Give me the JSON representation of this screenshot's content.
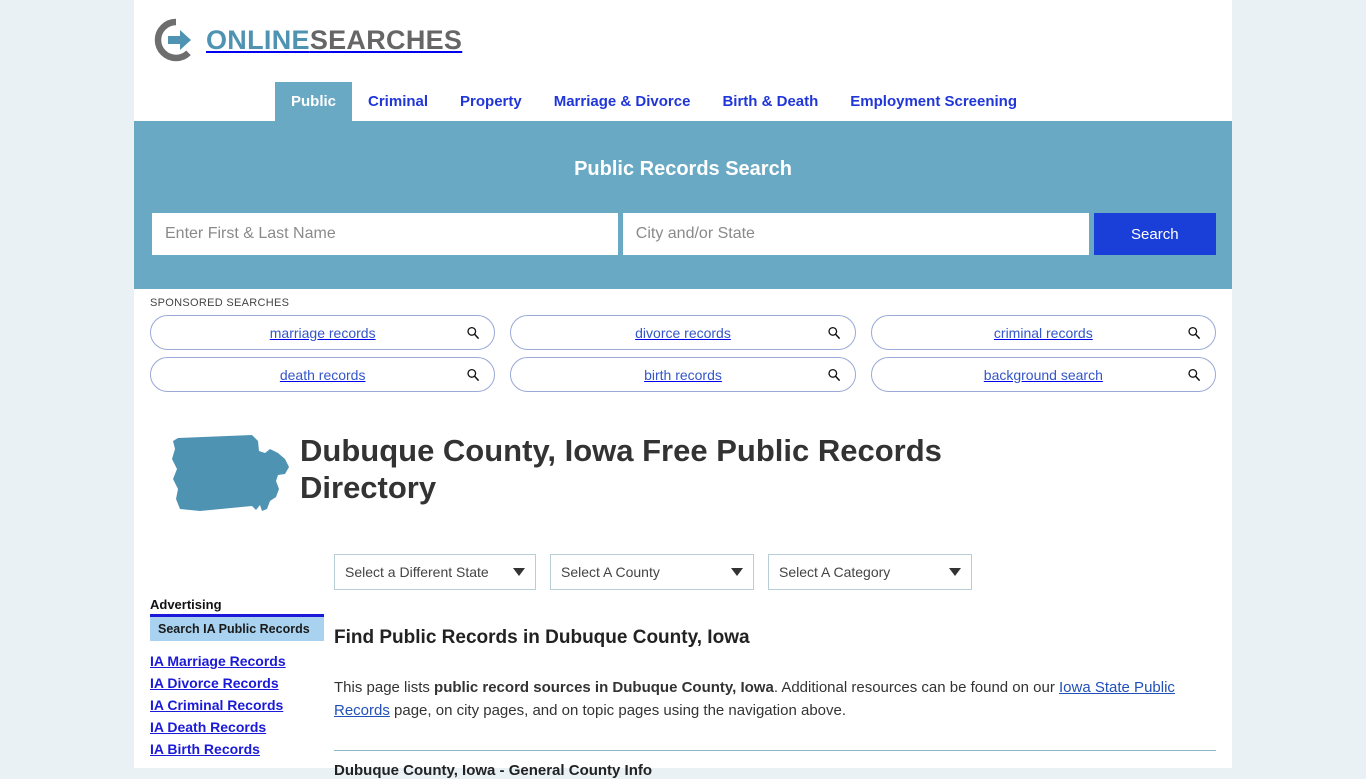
{
  "brand": {
    "logo_icon": "circle-arrow-icon",
    "name_part1": "ONLINE",
    "name_part2": "SEARCHES",
    "accent_color": "#4f93b3",
    "gray_color": "#666666"
  },
  "nav": {
    "items": [
      {
        "label": "Public",
        "active": true
      },
      {
        "label": "Criminal",
        "active": false
      },
      {
        "label": "Property",
        "active": false
      },
      {
        "label": "Marriage & Divorce",
        "active": false
      },
      {
        "label": "Birth & Death",
        "active": false
      },
      {
        "label": "Employment Screening",
        "active": false
      }
    ],
    "active_bg": "#6aa9c4",
    "link_color": "#2036d8"
  },
  "hero": {
    "title": "Public Records Search",
    "background_color": "#6aa9c4",
    "name_placeholder": "Enter First & Last Name",
    "name_value": "",
    "location_placeholder": "City and/or State",
    "location_value": "",
    "search_label": "Search",
    "search_button_color": "#1a3ed8"
  },
  "sponsored": {
    "label": "SPONSORED SEARCHES",
    "icon": "magnifier-icon",
    "row1": [
      {
        "label": "marriage records"
      },
      {
        "label": "divorce records"
      },
      {
        "label": "criminal records"
      }
    ],
    "row2": [
      {
        "label": "death records"
      },
      {
        "label": "birth records"
      },
      {
        "label": "background search"
      }
    ]
  },
  "page": {
    "state_map_icon": "iowa-state-map-icon",
    "state_map_color": "#4f93b3",
    "title": "Dubuque County, Iowa Free Public Records Directory"
  },
  "selectors": [
    {
      "label": "Select a Different State",
      "icon": "chevron-down-icon"
    },
    {
      "label": "Select A County",
      "icon": "chevron-down-icon"
    },
    {
      "label": "Select A Category",
      "icon": "chevron-down-icon"
    }
  ],
  "content": {
    "section_heading": "Find Public Records in Dubuque County, Iowa",
    "intro_pre": "This page lists ",
    "intro_bold": "public record sources in Dubuque County, Iowa",
    "intro_mid": ". Additional resources can be found on our ",
    "intro_link": "Iowa State Public Records",
    "intro_post": " page, on city pages, and on topic pages using the navigation above.",
    "subsection_heading": "Dubuque County, Iowa - General County Info"
  },
  "advertising": {
    "title": "Advertising",
    "banner": "Search IA Public Records",
    "banner_color": "#a8d2f0",
    "links": [
      "IA Marriage Records",
      "IA Divorce Records",
      "IA Criminal Records",
      "IA Death Records",
      "IA Birth Records"
    ]
  }
}
